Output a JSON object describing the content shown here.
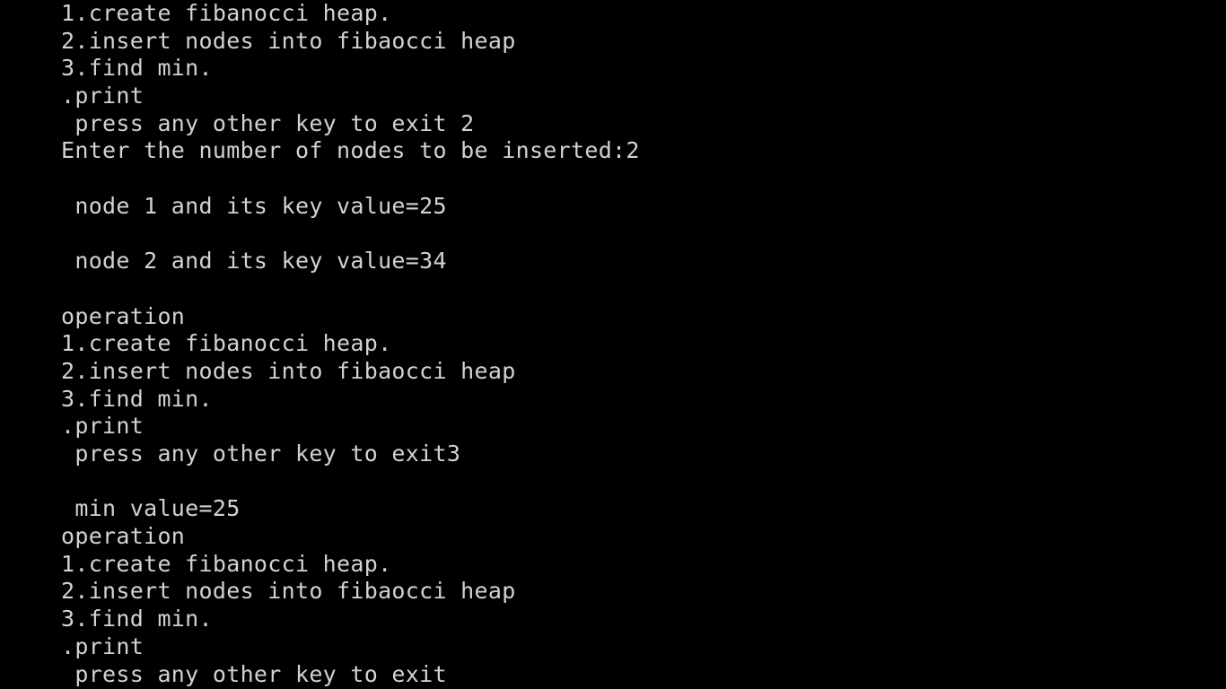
{
  "terminal": {
    "background": "#000000",
    "foreground": "#d2d2d2",
    "lines": [
      "1.create fibanocci heap.",
      "2.insert nodes into fibaocci heap",
      "3.find min.",
      ".print",
      " press any other key to exit 2",
      "Enter the number of nodes to be inserted:2",
      "",
      " node 1 and its key value=25",
      "",
      " node 2 and its key value=34",
      "",
      "operation",
      "1.create fibanocci heap.",
      "2.insert nodes into fibaocci heap",
      "3.find min.",
      ".print",
      " press any other key to exit3",
      "",
      " min value=25",
      "operation",
      "1.create fibanocci heap.",
      "2.insert nodes into fibaocci heap",
      "3.find min.",
      ".print",
      " press any other key to exit"
    ]
  }
}
